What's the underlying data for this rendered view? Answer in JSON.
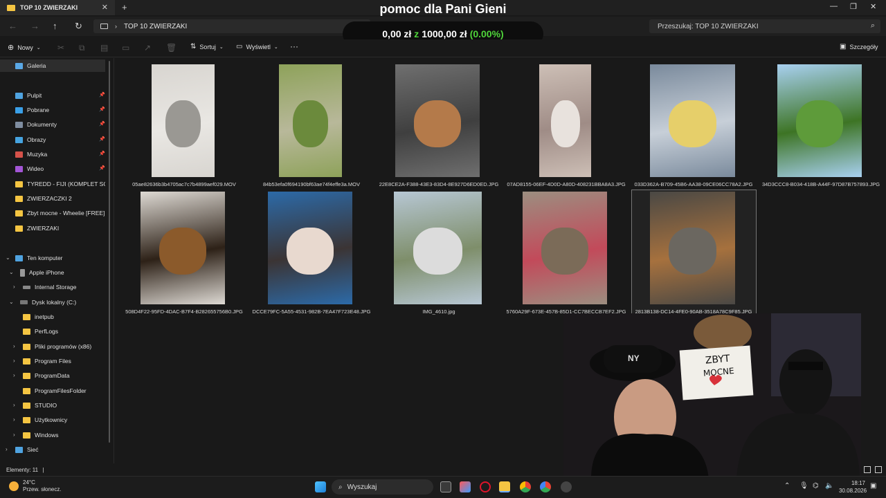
{
  "window": {
    "tab_title": "TOP 10 ZWIERZAKI",
    "new_tab": "+",
    "minimize": "—",
    "maximize": "❐",
    "close": "✕"
  },
  "overlay": {
    "title": "pomoc dla Pani Gieni",
    "amount": "0,00 zł",
    "of": "z",
    "goal": "1000,00 zł",
    "percent": "(0.00%)"
  },
  "address": {
    "crumb": "TOP 10 ZWIERZAKI",
    "search_placeholder": "Przeszukaj: TOP 10 ZWIERZAKI"
  },
  "toolbar": {
    "new_label": "Nowy",
    "sort_label": "Sortuj",
    "view_label": "Wyświetl",
    "more_label": "···",
    "details_label": "Szczegóły"
  },
  "sidebar": {
    "gallery": "Galeria",
    "quick": [
      "Pulpit",
      "Pobrane",
      "Dokumenty",
      "Obrazy",
      "Muzyka",
      "Wideo",
      "TYREDD - FIJI (KOMPLET SCIEŻ",
      "ZWIERZACZKI 2",
      "Zbyt mocne - Wheelie [FREE] TRA",
      "ZWIERZAKI"
    ],
    "this_pc": "Ten komputer",
    "iphone": "Apple iPhone",
    "internal": "Internal Storage",
    "disk": "Dysk lokalny (C:)",
    "folders": [
      "inetpub",
      "PerfLogs",
      "Pliki programów (x86)",
      "Program Files",
      "ProgramData",
      "ProgramFilesFolder",
      "STUDIO",
      "Użytkownicy",
      "Windows"
    ],
    "network": "Sieć"
  },
  "files": [
    {
      "name": "05ae82636b3b4705ac7c7b4899aef029.MOV",
      "colors": [
        "#d8d5d0",
        "#9a9893",
        "#e9e7e3"
      ]
    },
    {
      "name": "84b53efa0f694190bf63ae74f4effe3a.MOV",
      "colors": [
        "#8ea25a",
        "#6b8a3c",
        "#b8b89a"
      ]
    },
    {
      "name": "22E8CE2A-F388-43E3-83D4-8E927D6ED0ED.JPG",
      "colors": [
        "#6f6f6f",
        "#b47a4a",
        "#3f3f3f"
      ]
    },
    {
      "name": "07AD8155-06EF-4D0D-A80D-408231BBA8A3.JPG",
      "colors": [
        "#cdbfb6",
        "#e8e2dd",
        "#9f8c86"
      ]
    },
    {
      "name": "033D362A-B709-45B6-AA38-09CE06CC78A2.JPG",
      "colors": [
        "#7a8a9c",
        "#e6cf6a",
        "#c7cfd8"
      ]
    },
    {
      "name": "34D3CCC8-B034-418B-A44F-97D87B757893.JPG",
      "colors": [
        "#a8d0f0",
        "#5e9b3a",
        "#3d7424"
      ]
    },
    {
      "name": "508D4F22-95FD-4DAC-B7F4-B282655756B0.JPG",
      "colors": [
        "#dedad4",
        "#8b5a2b",
        "#2d2117"
      ]
    },
    {
      "name": "DCCE79FC-5A55-4531-982B-7EA47F723E48.JPG",
      "colors": [
        "#2c6aa8",
        "#e8d9cf",
        "#3b3434"
      ]
    },
    {
      "name": "IMG_4610.jpg",
      "colors": [
        "#b7c7d4",
        "#dcdcdc",
        "#7e8e6a"
      ]
    },
    {
      "name": "5760A29F-673E-457B-85D1-CC7BECCB7EF2.JPG",
      "colors": [
        "#9c8e80",
        "#7b6b58",
        "#c24a5a"
      ]
    },
    {
      "name": "2813B138-DC14-4FE0-90AB-3518A78C9F85.JPG",
      "colors": [
        "#4a4844",
        "#6b6760",
        "#a6713e"
      ]
    }
  ],
  "status": {
    "items": "Elementy: 11",
    "cursor": "|"
  },
  "webcam": {
    "sign_line1": "ZBYT",
    "sign_line2": "MOCNE",
    "cap_logo": "NY"
  },
  "taskbar": {
    "temp": "24°C",
    "weather": "Przew. słonecz.",
    "search": "Wyszukaj",
    "time": "18:17",
    "date": "30.08.2026"
  },
  "colors": {
    "accent_green": "#4fd43a",
    "folder_yellow": "#f5c542",
    "background": "#191919"
  }
}
